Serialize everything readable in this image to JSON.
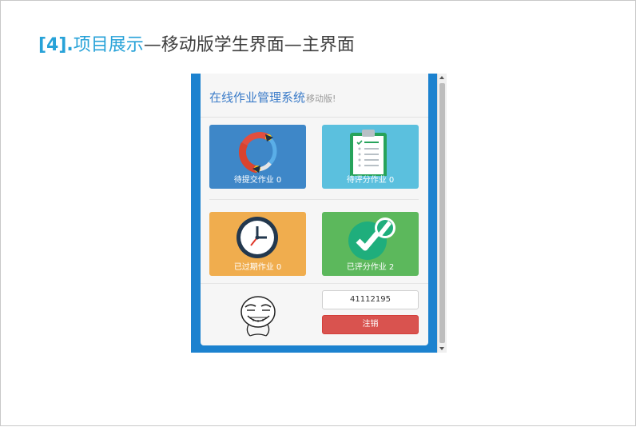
{
  "slide": {
    "title_num": "[4].",
    "title_main": "项目展示",
    "title_rest": "—移动版学生界面—主界面"
  },
  "app": {
    "title": "在线作业管理系统",
    "subtitle": "移动版!"
  },
  "tiles": [
    {
      "label": "待提交作业",
      "count": "0",
      "icon": "refresh-arrows-icon",
      "color": "#3e87c8"
    },
    {
      "label": "待评分作业",
      "count": "0",
      "icon": "clipboard-checklist-icon",
      "color": "#5bc0de"
    },
    {
      "label": "已过期作业",
      "count": "0",
      "icon": "clock-icon",
      "color": "#f0ad4e"
    },
    {
      "label": "已评分作业",
      "count": "2",
      "icon": "checkmark-badge-icon",
      "color": "#5cb85c"
    }
  ],
  "user": {
    "id": "41112195",
    "logout_label": "注销",
    "avatar": "meme-face-avatar"
  }
}
